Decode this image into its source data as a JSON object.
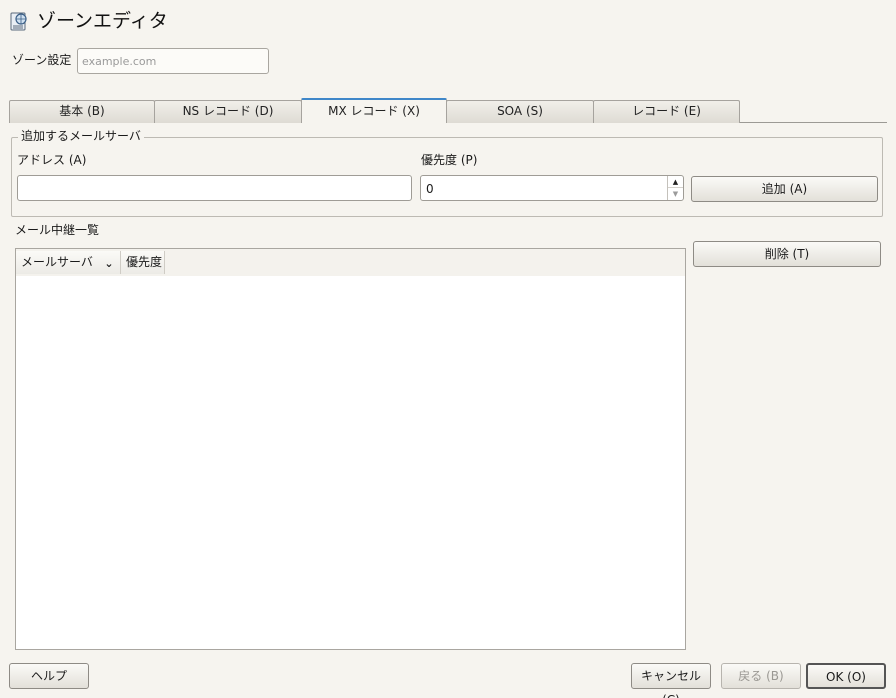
{
  "window": {
    "title": "ゾーンエディタ",
    "icon": "dns-server-icon"
  },
  "zone": {
    "label": "ゾーン設定",
    "placeholder": "example.com",
    "value": ""
  },
  "tabs": [
    {
      "label": "基本 (B)",
      "active": false
    },
    {
      "label": "NS レコード (D)",
      "active": false
    },
    {
      "label": "MX レコード (X)",
      "active": true
    },
    {
      "label": "SOA (S)",
      "active": false
    },
    {
      "label": "レコード (E)",
      "active": false
    }
  ],
  "add_group": {
    "title": "追加するメールサーバ",
    "address_label": "アドレス (A)",
    "address_value": "",
    "priority_label": "優先度 (P)",
    "priority_value": "0",
    "add_button": "追加 (A)"
  },
  "relay_list": {
    "label": "メール中継一覧",
    "columns": [
      "メールサーバ",
      "優先度"
    ],
    "rows": [],
    "delete_button": "削除 (T)"
  },
  "footer": {
    "help": "ヘルプ",
    "cancel": "キャンセル (C)",
    "back": "戻る (B)",
    "ok": "OK (O)"
  },
  "colors": {
    "background": "#f6f4ef",
    "active_tab_accent": "#3f87c9"
  }
}
